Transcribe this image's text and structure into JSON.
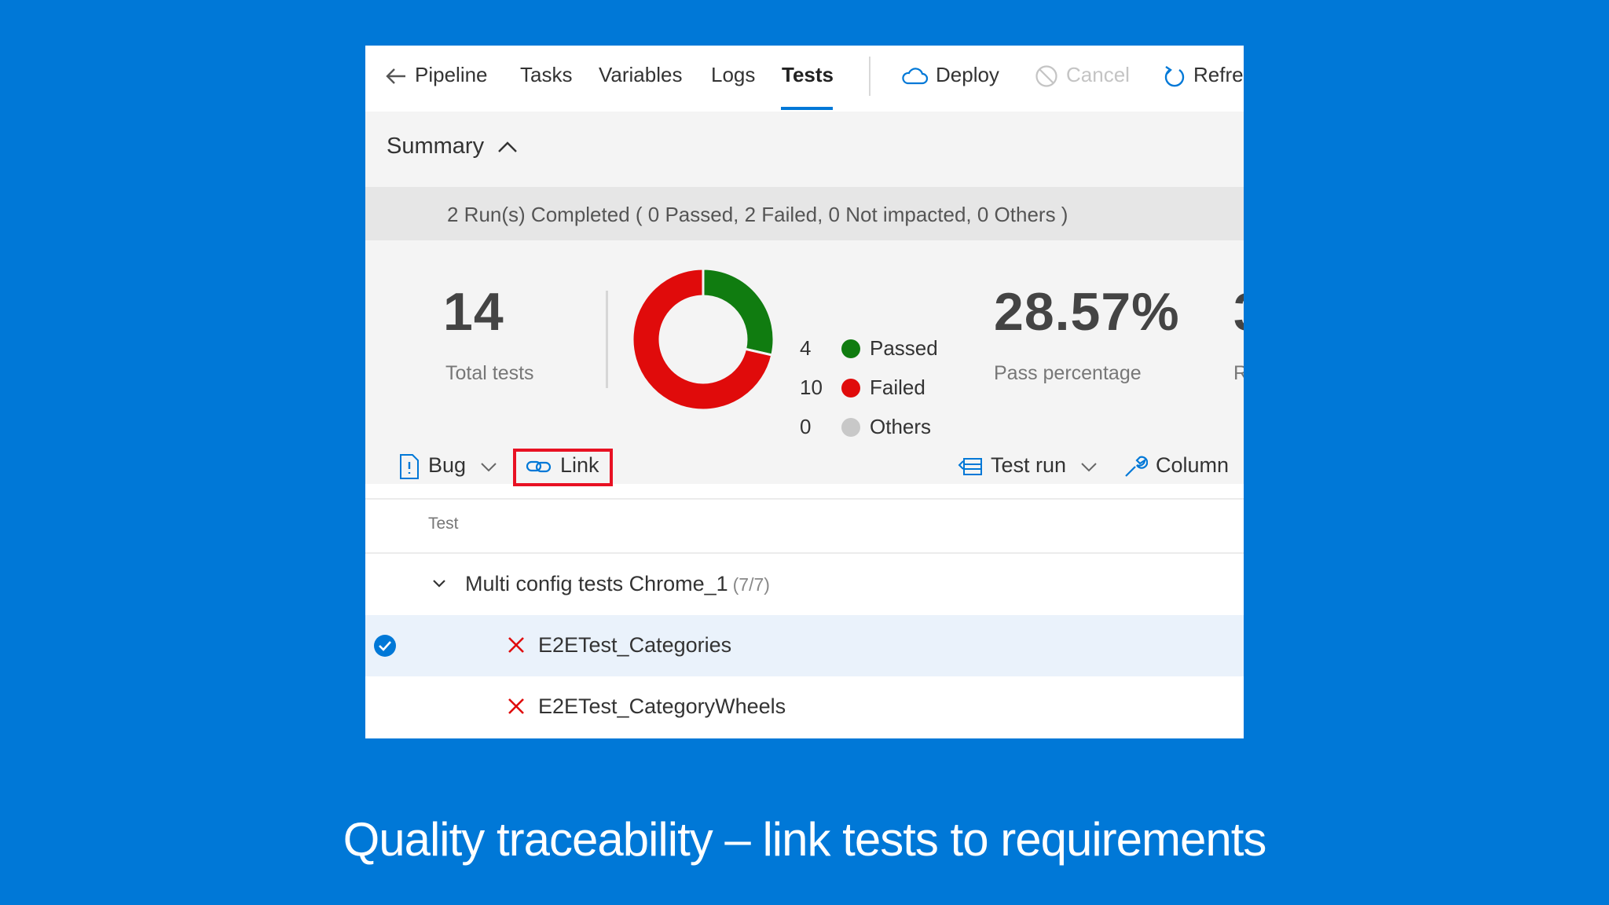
{
  "nav": {
    "pipeline": "Pipeline",
    "tasks": "Tasks",
    "variables": "Variables",
    "logs": "Logs",
    "tests": "Tests",
    "deploy": "Deploy",
    "cancel": "Cancel",
    "refresh": "Refre"
  },
  "summary": {
    "heading": "Summary",
    "runs_text": "2 Run(s) Completed ( 0 Passed, 2 Failed, 0 Not impacted, 0 Others )",
    "total_value": "14",
    "total_label": "Total tests",
    "pass_value": "28.57%",
    "pass_label": "Pass percentage",
    "next_value": "3",
    "next_label": "R"
  },
  "chart_data": {
    "type": "pie",
    "categories": [
      "Passed",
      "Failed",
      "Others"
    ],
    "values": [
      4,
      10,
      0
    ],
    "colors": [
      "#107c10",
      "#e00b0b",
      "#c8c8c8"
    ]
  },
  "legend": [
    {
      "count": "4",
      "label": "Passed",
      "color": "#107c10"
    },
    {
      "count": "10",
      "label": "Failed",
      "color": "#e00b0b"
    },
    {
      "count": "0",
      "label": "Others",
      "color": "#c8c8c8"
    }
  ],
  "toolbar": {
    "bug": "Bug",
    "link": "Link",
    "test_run": "Test run",
    "column": "Column"
  },
  "table": {
    "header": "Test",
    "group": {
      "label": "Multi config tests Chrome_1",
      "count": "(7/7)"
    },
    "rows": [
      {
        "name": "E2ETest_Categories"
      },
      {
        "name": "E2ETest_CategoryWheels"
      }
    ]
  },
  "caption": "Quality traceability – link tests to requirements"
}
